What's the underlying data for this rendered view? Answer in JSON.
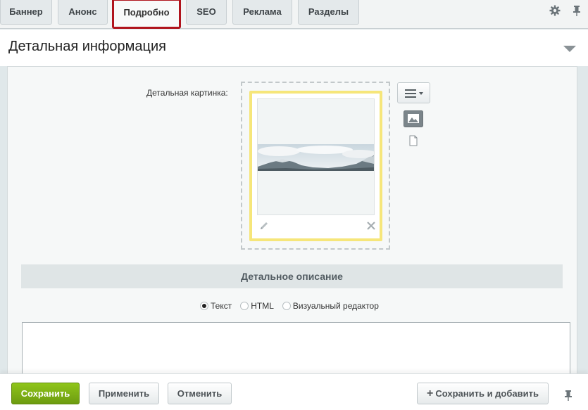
{
  "tabs": [
    {
      "label": "Баннер",
      "active": false
    },
    {
      "label": "Анонс",
      "active": false
    },
    {
      "label": "Подробно",
      "active": true
    },
    {
      "label": "SEO",
      "active": false
    },
    {
      "label": "Реклама",
      "active": false
    },
    {
      "label": "Разделы",
      "active": false
    }
  ],
  "icons": {
    "settings": "gear-icon",
    "pin": "pin-icon",
    "collapse": "chevron-down-icon"
  },
  "section": {
    "title": "Детальная информация"
  },
  "picture": {
    "label": "Детальная картинка:"
  },
  "description": {
    "header": "Детальное описание",
    "modes": [
      {
        "label": "Текст",
        "checked": true
      },
      {
        "label": "HTML",
        "checked": false
      },
      {
        "label": "Визуальный редактор",
        "checked": false
      }
    ],
    "value": ""
  },
  "footer": {
    "save": "Сохранить",
    "apply": "Применить",
    "cancel": "Отменить",
    "save_add": "Сохранить и добавить"
  },
  "colors": {
    "accent_green": "#7cb314",
    "active_tab_border": "#b0141d",
    "image_frame": "#f6e67a"
  }
}
